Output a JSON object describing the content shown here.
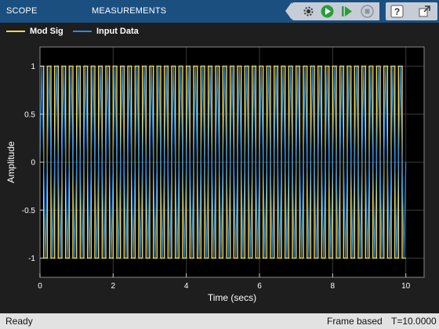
{
  "toolstrip": {
    "tabs": [
      {
        "label": "SCOPE"
      },
      {
        "label": "MEASUREMENTS"
      }
    ],
    "buttons": [
      "settings-gear-icon",
      "run-icon",
      "step-forward-icon",
      "stop-icon",
      "help-icon",
      "undock-icon"
    ]
  },
  "legend": [
    {
      "label": "Mod Sig",
      "color": "#f5d84e"
    },
    {
      "label": "Input Data",
      "color": "#2b8ce0"
    }
  ],
  "chart_data": {
    "type": "line",
    "xlabel": "Time (secs)",
    "ylabel": "Amplitude",
    "xlim": [
      0,
      10.5
    ],
    "ylim": [
      -1.2,
      1.2
    ],
    "x_ticks": [
      0,
      2,
      4,
      6,
      8,
      10
    ],
    "y_ticks": [
      1,
      0.5,
      0,
      -0.5,
      -1
    ],
    "grid": true,
    "series": [
      {
        "name": "Mod Sig",
        "color": "#f5d84e",
        "shape": "square wave",
        "cycles_per_sec": 5,
        "amplitude": 1,
        "t_start": 0,
        "t_end": 10
      },
      {
        "name": "Input Data",
        "color": "#2b8ce0",
        "shape": "triangle wave",
        "cycles_per_sec": 5,
        "amplitude": 1,
        "t_start": 0,
        "t_end": 10
      }
    ]
  },
  "status": {
    "left": "Ready",
    "mode": "Frame based",
    "time": "T=10.0000"
  }
}
